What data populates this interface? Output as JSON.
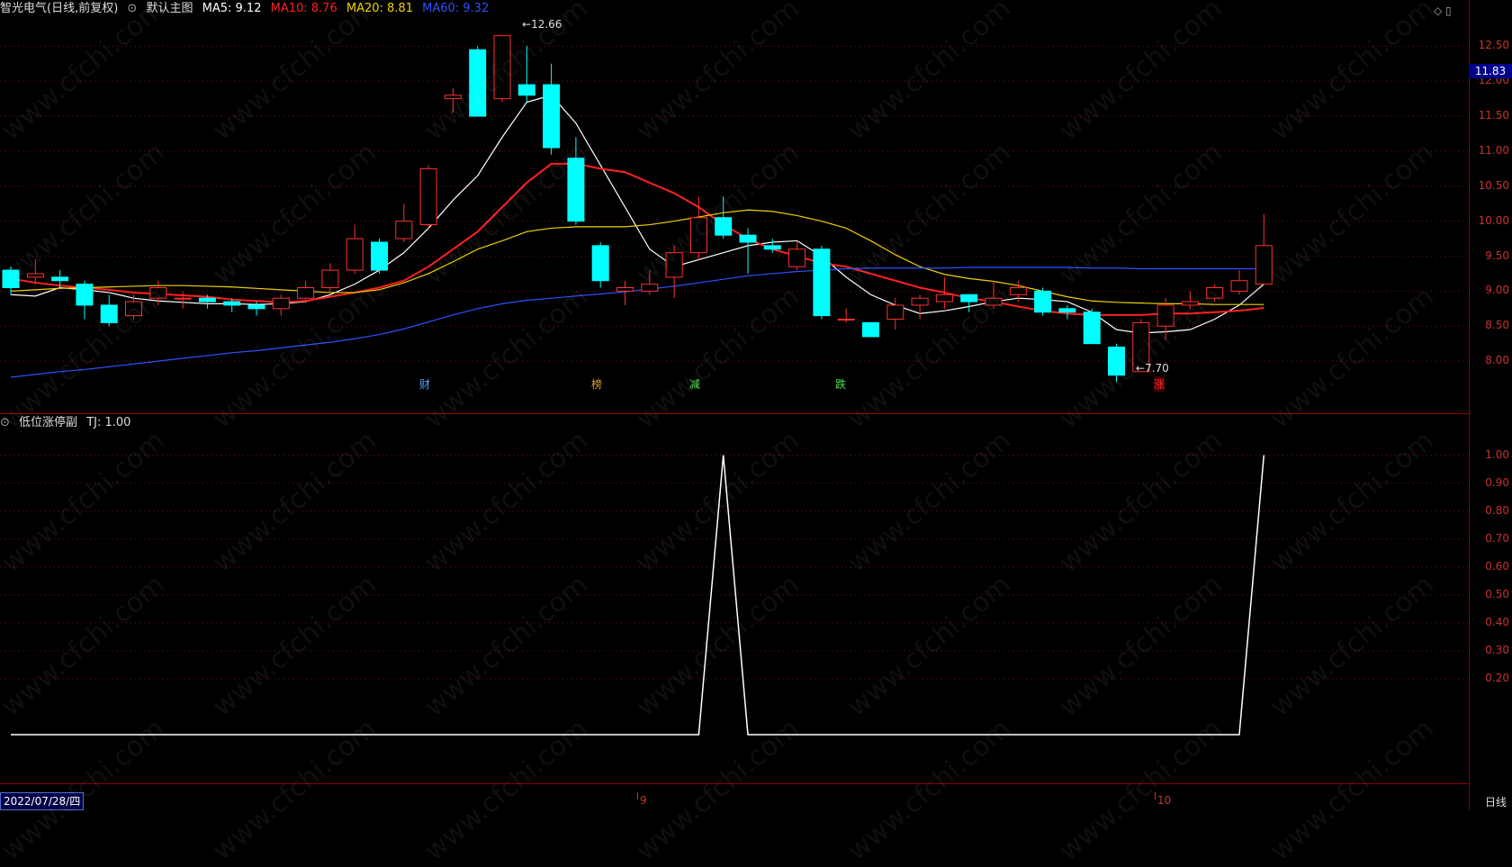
{
  "main": {
    "stock_name": "智光电气(日线,前复权)",
    "template": "默认主图",
    "indicators": [
      {
        "label": "MA5: 9.12",
        "color": "#ffffff"
      },
      {
        "label": "MA10: 8.76",
        "color": "#ff2020"
      },
      {
        "label": "MA20: 8.81",
        "color": "#f0d000"
      },
      {
        "label": "MA60: 9.32",
        "color": "#3050ff"
      }
    ],
    "high_mark": "12.66",
    "low_mark": "7.70",
    "current_price": "11.83",
    "events": [
      {
        "text": "财",
        "color": "#5aa0ff"
      },
      {
        "text": "榜",
        "color": "#e0a030"
      },
      {
        "text": "减",
        "color": "#50e050"
      },
      {
        "text": "跌",
        "color": "#50e050"
      },
      {
        "text": "涨",
        "color": "#ff3030"
      }
    ],
    "y_ticks": [
      "12.50",
      "12.00",
      "11.50",
      "11.00",
      "10.50",
      "10.00",
      "9.50",
      "9.00",
      "8.50",
      "8.00"
    ],
    "top_icons": "◇ ▯"
  },
  "sub": {
    "title": "低位涨停副",
    "value_label": "TJ: 1.00",
    "y_ticks": [
      "1.00",
      "0.90",
      "0.80",
      "0.70",
      "0.60",
      "0.50",
      "0.40",
      "0.30",
      "0.20"
    ]
  },
  "bottom": {
    "date": "2022/07/28/四",
    "months": [
      "9",
      "10"
    ],
    "period": "日线"
  },
  "watermark": "www.cfchi.com",
  "chart_data": {
    "type": "candlestick",
    "ylim": [
      7.5,
      12.8
    ],
    "candles": [
      [
        9.3,
        9.05,
        9.35,
        8.95
      ],
      [
        9.2,
        9.25,
        9.45,
        9.1
      ],
      [
        9.2,
        9.15,
        9.3,
        9.05
      ],
      [
        9.1,
        8.8,
        9.15,
        8.6
      ],
      [
        8.8,
        8.55,
        8.95,
        8.5
      ],
      [
        8.65,
        8.85,
        8.95,
        8.6
      ],
      [
        8.9,
        9.05,
        9.15,
        8.8
      ],
      [
        8.9,
        8.9,
        9.0,
        8.75
      ],
      [
        8.9,
        8.85,
        8.95,
        8.75
      ],
      [
        8.85,
        8.8,
        8.9,
        8.7
      ],
      [
        8.8,
        8.75,
        8.85,
        8.65
      ],
      [
        8.75,
        8.9,
        8.95,
        8.65
      ],
      [
        8.9,
        9.05,
        9.15,
        8.85
      ],
      [
        9.05,
        9.3,
        9.4,
        9.0
      ],
      [
        9.3,
        9.75,
        9.95,
        9.25
      ],
      [
        9.7,
        9.3,
        9.75,
        9.25
      ],
      [
        9.75,
        10.0,
        10.25,
        9.7
      ],
      [
        9.95,
        10.75,
        10.8,
        9.9
      ],
      [
        11.75,
        11.8,
        11.9,
        11.55
      ],
      [
        12.45,
        11.5,
        12.5,
        11.5
      ],
      [
        11.75,
        12.65,
        12.66,
        11.7
      ],
      [
        11.95,
        11.8,
        12.5,
        11.7
      ],
      [
        11.95,
        11.05,
        12.25,
        10.95
      ],
      [
        10.9,
        10.0,
        11.2,
        9.95
      ],
      [
        9.65,
        9.15,
        9.7,
        9.05
      ],
      [
        9.0,
        9.05,
        9.15,
        8.8
      ],
      [
        9.0,
        9.1,
        9.3,
        8.95
      ],
      [
        9.2,
        9.55,
        9.65,
        8.9
      ],
      [
        9.55,
        10.05,
        10.35,
        9.45
      ],
      [
        10.05,
        9.8,
        10.35,
        9.75
      ],
      [
        9.8,
        9.7,
        9.9,
        9.25
      ],
      [
        9.65,
        9.6,
        9.75,
        9.55
      ],
      [
        9.35,
        9.6,
        9.7,
        9.3
      ],
      [
        9.6,
        8.65,
        9.65,
        8.6
      ],
      [
        8.6,
        8.6,
        8.75,
        8.55
      ],
      [
        8.55,
        8.35,
        8.55,
        8.35
      ],
      [
        8.6,
        8.8,
        8.9,
        8.45
      ],
      [
        8.8,
        8.9,
        8.95,
        8.6
      ],
      [
        8.85,
        8.95,
        9.2,
        8.75
      ],
      [
        8.95,
        8.85,
        8.95,
        8.7
      ],
      [
        8.8,
        8.9,
        9.15,
        8.75
      ],
      [
        8.95,
        9.05,
        9.15,
        8.85
      ],
      [
        9.0,
        8.7,
        9.05,
        8.65
      ],
      [
        8.75,
        8.7,
        8.8,
        8.6
      ],
      [
        8.7,
        8.25,
        8.75,
        8.25
      ],
      [
        8.2,
        7.8,
        8.25,
        7.7
      ],
      [
        7.85,
        8.55,
        8.6,
        7.85
      ],
      [
        8.5,
        8.8,
        8.9,
        8.3
      ],
      [
        8.8,
        8.85,
        9.0,
        8.75
      ],
      [
        8.9,
        9.05,
        9.1,
        8.85
      ],
      [
        9.0,
        9.15,
        9.3,
        8.95
      ],
      [
        9.1,
        9.65,
        10.1,
        9.1
      ]
    ],
    "series": [
      {
        "name": "MA5",
        "color": "#ffffff",
        "values": [
          8.95,
          8.93,
          9.05,
          9.02,
          8.98,
          8.9,
          8.86,
          8.84,
          8.82,
          8.82,
          8.81,
          8.82,
          8.85,
          8.95,
          9.1,
          9.3,
          9.55,
          9.9,
          10.3,
          10.65,
          11.2,
          11.7,
          11.8,
          11.4,
          10.8,
          10.2,
          9.6,
          9.35,
          9.45,
          9.55,
          9.65,
          9.7,
          9.72,
          9.5,
          9.2,
          8.95,
          8.8,
          8.68,
          8.72,
          8.78,
          8.85,
          8.9,
          8.88,
          8.85,
          8.7,
          8.45,
          8.4,
          8.42,
          8.45,
          8.6,
          8.8,
          9.1
        ]
      },
      {
        "name": "MA10",
        "color": "#ff2020",
        "values": [
          9.18,
          9.12,
          9.08,
          9.05,
          9.02,
          8.98,
          8.96,
          8.94,
          8.92,
          8.88,
          8.86,
          8.84,
          8.86,
          8.92,
          8.98,
          9.05,
          9.15,
          9.35,
          9.6,
          9.85,
          10.2,
          10.55,
          10.82,
          10.82,
          10.75,
          10.7,
          10.55,
          10.4,
          10.2,
          9.95,
          9.75,
          9.6,
          9.5,
          9.4,
          9.35,
          9.25,
          9.15,
          9.05,
          8.98,
          8.9,
          8.85,
          8.78,
          8.72,
          8.68,
          8.66,
          8.66,
          8.66,
          8.68,
          8.68,
          8.7,
          8.72,
          8.76
        ]
      },
      {
        "name": "MA20",
        "color": "#f0d000",
        "values": [
          9.0,
          9.02,
          9.04,
          9.05,
          9.06,
          9.07,
          9.08,
          9.08,
          9.07,
          9.06,
          9.04,
          9.02,
          9.0,
          8.98,
          8.98,
          9.02,
          9.12,
          9.25,
          9.42,
          9.6,
          9.72,
          9.85,
          9.9,
          9.92,
          9.92,
          9.92,
          9.95,
          10.0,
          10.06,
          10.12,
          10.16,
          10.14,
          10.08,
          10.0,
          9.9,
          9.72,
          9.52,
          9.35,
          9.24,
          9.18,
          9.14,
          9.08,
          9.0,
          8.92,
          8.86,
          8.84,
          8.83,
          8.82,
          8.82,
          8.81,
          8.81,
          8.81
        ]
      },
      {
        "name": "MA60",
        "color": "#3050ff",
        "values": [
          7.77,
          7.81,
          7.85,
          7.88,
          7.92,
          7.96,
          8.0,
          8.04,
          8.08,
          8.12,
          8.15,
          8.19,
          8.23,
          8.27,
          8.32,
          8.38,
          8.46,
          8.56,
          8.66,
          8.75,
          8.82,
          8.87,
          8.9,
          8.93,
          8.96,
          8.99,
          9.03,
          9.07,
          9.12,
          9.17,
          9.22,
          9.25,
          9.28,
          9.3,
          9.32,
          9.33,
          9.33,
          9.33,
          9.33,
          9.34,
          9.34,
          9.34,
          9.34,
          9.34,
          9.33,
          9.33,
          9.32,
          9.32,
          9.32,
          9.32,
          9.32,
          9.32
        ]
      }
    ],
    "sub_series": {
      "name": "TJ",
      "ylim": [
        0,
        1.05
      ],
      "values": [
        0,
        0,
        0,
        0,
        0,
        0,
        0,
        0,
        0,
        0,
        0,
        0,
        0,
        0,
        0,
        0,
        0,
        0,
        0,
        0,
        0,
        0,
        0,
        0,
        0,
        0,
        0,
        0,
        0,
        1,
        0,
        0,
        0,
        0,
        0,
        0,
        0,
        0,
        0,
        0,
        0,
        0,
        0,
        0,
        0,
        0,
        0,
        0,
        0,
        0,
        0,
        1
      ]
    }
  }
}
